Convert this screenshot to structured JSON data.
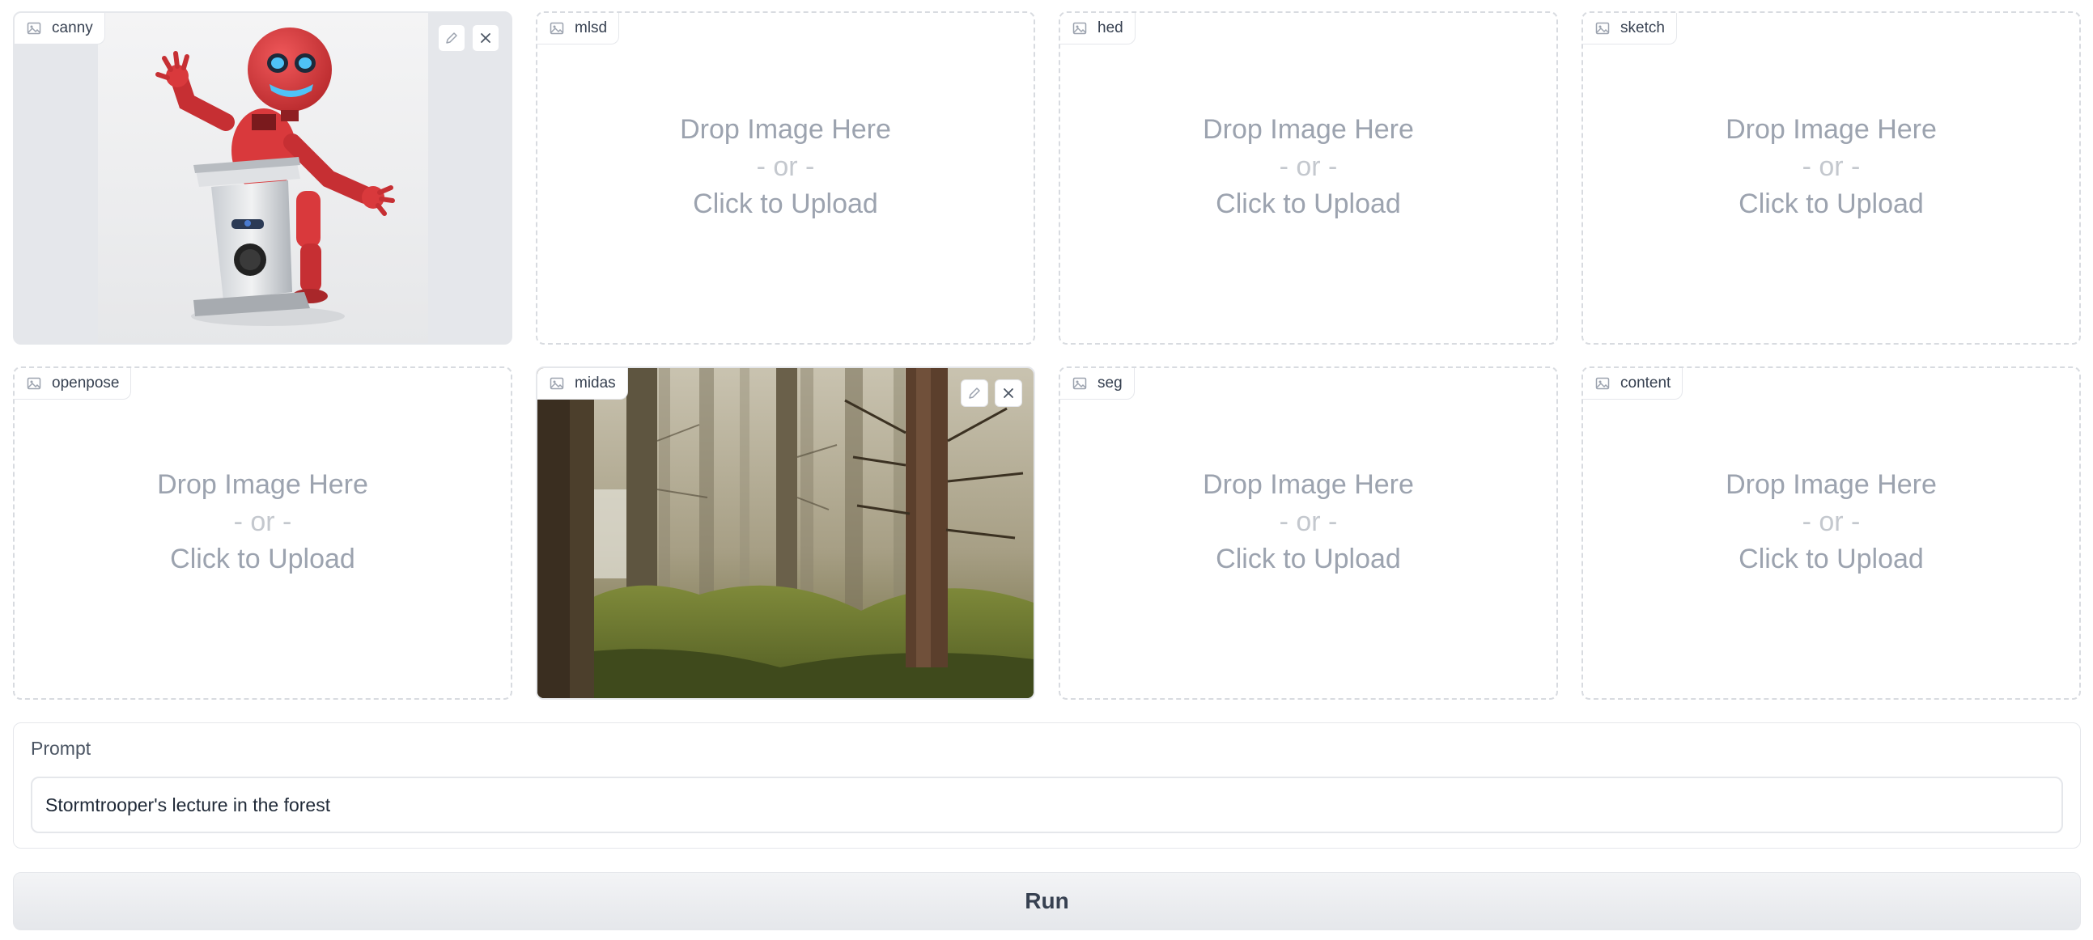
{
  "inputs": [
    {
      "label": "canny",
      "state": "filled"
    },
    {
      "label": "mlsd",
      "state": "empty"
    },
    {
      "label": "hed",
      "state": "empty"
    },
    {
      "label": "sketch",
      "state": "empty"
    },
    {
      "label": "openpose",
      "state": "empty"
    },
    {
      "label": "midas",
      "state": "filled"
    },
    {
      "label": "seg",
      "state": "empty"
    },
    {
      "label": "content",
      "state": "empty"
    }
  ],
  "dropzone": {
    "line1": "Drop Image Here",
    "line2": "- or -",
    "line3": "Click to Upload"
  },
  "prompt": {
    "label": "Prompt",
    "value": "Stormtrooper's lecture in the forest"
  },
  "run_label": "Run",
  "colors": {
    "robot_red": "#d9393c",
    "border": "#e5e7eb",
    "muted_text": "#9ca3af"
  }
}
